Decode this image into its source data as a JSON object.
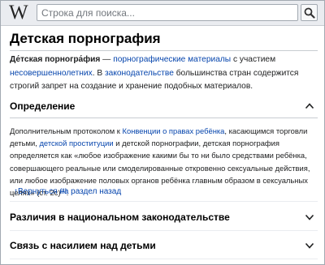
{
  "header": {
    "logo": "W",
    "search_placeholder": "Строка для поиска..."
  },
  "page": {
    "title": "Детская порнография"
  },
  "intro": {
    "term": "Де́тская порногра́фия",
    "dash": " — ",
    "link1": "порнографические материалы",
    "text1": " с участием ",
    "link2": "несовершеннолетних",
    "text2": ". В ",
    "link3": "законодательстве",
    "text3": " большинства стран содержится строгий запрет на создание и хранение подобных материалов."
  },
  "sections": [
    {
      "title": "Определение",
      "expanded": true
    },
    {
      "title": "Различия в национальном законодательстве",
      "expanded": false
    },
    {
      "title": "Связь с насилием над детьми",
      "expanded": false
    }
  ],
  "definition": {
    "text1": "Дополнительным протоколом к ",
    "link1": "Конвенции о правах ребёнка",
    "text2": ", касающимся торговли детьми, ",
    "link2": "детской проституции",
    "text3": " и детской порнографии, детская порнография определяется как «любое изображение какими бы то ни было средствами ребёнка, совершающего реальные или смоделированные откровенно сексуальные действия, или любое изображение половых органов ребёнка главным образом в сексуальных целях» (ст. 2c)",
    "ref": "[1]",
    "text4": ".",
    "back_link": "↑Вернуться на раздел назад"
  },
  "icons": {
    "logo": "wikipedia-w",
    "search": "magnifier-icon",
    "expanded": "chevron-up-icon",
    "collapsed": "chevron-down-icon"
  }
}
